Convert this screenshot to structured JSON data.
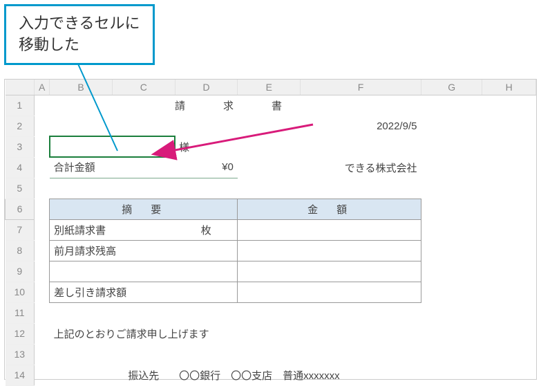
{
  "chart_data": {
    "type": "table",
    "title": "請求書 (Invoice) spreadsheet with annotation callout",
    "callout": "入力できるセルに移動した",
    "columns": [
      "A",
      "B",
      "C",
      "D",
      "E",
      "F",
      "G",
      "H"
    ],
    "rows": [
      {
        "n": 1,
        "content": {
          "title": "請　求　書"
        }
      },
      {
        "n": 2,
        "content": {
          "F": "2022/9/5"
        }
      },
      {
        "n": 3,
        "content": {
          "B:C": "(selected merged cell)",
          "D": "様"
        }
      },
      {
        "n": 4,
        "content": {
          "B": "合計金額",
          "D": "¥0",
          "F": "できる株式会社"
        }
      },
      {
        "n": 5
      },
      {
        "n": 6,
        "content": {
          "B:D": "摘　要",
          "E:F": "金　額"
        }
      },
      {
        "n": 7,
        "content": {
          "B": "別紙請求書",
          "D": "枚"
        }
      },
      {
        "n": 8,
        "content": {
          "B": "前月請求残高"
        }
      },
      {
        "n": 9
      },
      {
        "n": 10,
        "content": {
          "B": "差し引き請求額"
        }
      },
      {
        "n": 11
      },
      {
        "n": 12,
        "content": {
          "B": "上記のとおりご請求申し上げます"
        }
      },
      {
        "n": 13
      },
      {
        "n": 14,
        "content": {
          "C": "振込先",
          "D:F": "〇〇銀行　〇〇支店　普通xxxxxxx"
        }
      }
    ]
  },
  "callout": {
    "text": "入力できるセルに\n移動した"
  },
  "cols": {
    "A": "A",
    "B": "B",
    "C": "C",
    "D": "D",
    "E": "E",
    "F": "F",
    "G": "G",
    "H": "H"
  },
  "rows": {
    "1": "1",
    "2": "2",
    "3": "3",
    "4": "4",
    "5": "5",
    "6": "6",
    "7": "7",
    "8": "8",
    "9": "9",
    "10": "10",
    "11": "11",
    "12": "12",
    "13": "13",
    "14": "14"
  },
  "doc": {
    "title": "請　求　書",
    "date": "2022/9/5",
    "customer_suffix": "様",
    "total_label": "合計金額",
    "total_value": "¥0",
    "company": "できる株式会社",
    "col_header_desc": "摘　要",
    "col_header_amount": "金　額",
    "item1": "別紙請求書",
    "item1_unit": "枚",
    "item2": "前月請求残高",
    "item3": "差し引き請求額",
    "footer_msg": "上記のとおりご請求申し上げます",
    "bank_label": "振込先",
    "bank_info": "〇〇銀行　〇〇支店　普通xxxxxxx"
  }
}
